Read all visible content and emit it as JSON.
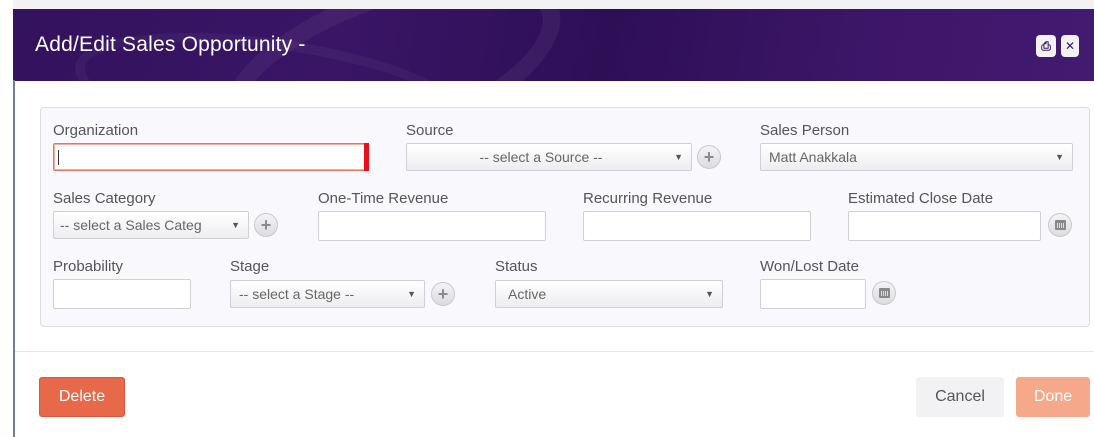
{
  "dialog": {
    "title": "Add/Edit Sales Opportunity -",
    "print_icon": "printer-icon",
    "close_icon": "close-icon"
  },
  "form": {
    "organization": {
      "label": "Organization",
      "value": "",
      "state": "error"
    },
    "source": {
      "label": "Source",
      "value": "-- select a Source --"
    },
    "sales_person": {
      "label": "Sales Person",
      "value": "Matt Anakkala"
    },
    "sales_category": {
      "label": "Sales Category",
      "value": "-- select a Sales Categ"
    },
    "one_time_revenue": {
      "label": "One-Time Revenue",
      "value": ""
    },
    "recurring_revenue": {
      "label": "Recurring Revenue",
      "value": ""
    },
    "estimated_close_date": {
      "label": "Estimated Close Date",
      "value": ""
    },
    "probability": {
      "label": "Probability",
      "value": ""
    },
    "stage": {
      "label": "Stage",
      "value": "-- select a Stage --"
    },
    "status": {
      "label": "Status",
      "value": "Active"
    },
    "won_lost_date": {
      "label": "Won/Lost Date",
      "value": ""
    }
  },
  "footer": {
    "delete_label": "Delete",
    "cancel_label": "Cancel",
    "done_label": "Done"
  },
  "colors": {
    "header_bg": "#33125e",
    "delete_bg": "#e8684a",
    "done_bg": "#f6a98a",
    "error_border": "#e07a5f"
  }
}
